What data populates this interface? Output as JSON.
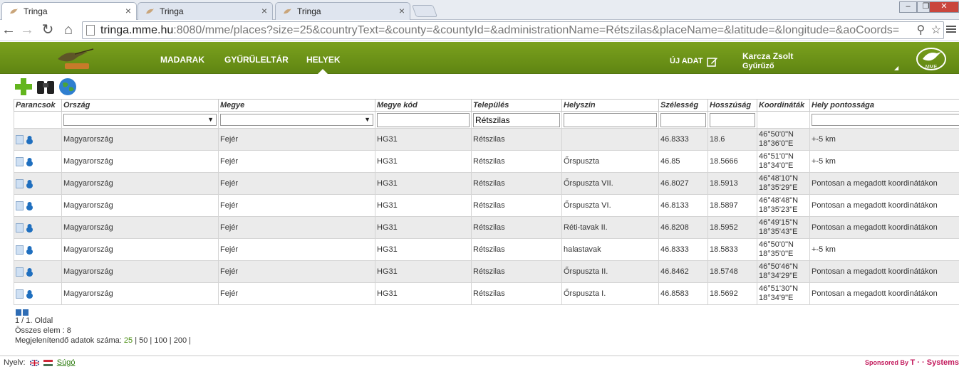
{
  "browser": {
    "tabs": [
      {
        "title": "Tringa"
      },
      {
        "title": "Tringa"
      },
      {
        "title": "Tringa"
      }
    ],
    "url_host": "tringa.mme.hu",
    "url_rest": ":8080/mme/places?size=25&countryText=&county=&countyId=&administrationName=Rétszilas&placeName=&latitude=&longitude=&aoCoords="
  },
  "header": {
    "nav": [
      "MADARAK",
      "GYŰRŰLELTÁR",
      "HELYEK"
    ],
    "new_data": "ÚJ ADAT",
    "user_name": "Karcza Zsolt",
    "user_role": "Gyűrűző"
  },
  "columns": [
    "Parancsok",
    "Ország",
    "Megye",
    "Megye kód",
    "Település",
    "Helyszín",
    "Szélesség",
    "Hosszúság",
    "Koordináták",
    "Hely pontossága"
  ],
  "filters": {
    "settlement": "Rétszilas"
  },
  "rows": [
    {
      "country": "Magyarország",
      "county": "Fejér",
      "code": "HG31",
      "settlement": "Rétszilas",
      "place": "",
      "lat": "46.8333",
      "lon": "18.6",
      "coord1": "46°50'0\"N",
      "coord2": "18°36'0\"E",
      "accuracy": "+-5 km"
    },
    {
      "country": "Magyarország",
      "county": "Fejér",
      "code": "HG31",
      "settlement": "Rétszilas",
      "place": "Őrspuszta",
      "lat": "46.85",
      "lon": "18.5666",
      "coord1": "46°51'0\"N",
      "coord2": "18°34'0\"E",
      "accuracy": "+-5 km"
    },
    {
      "country": "Magyarország",
      "county": "Fejér",
      "code": "HG31",
      "settlement": "Rétszilas",
      "place": "Őrspuszta VII.",
      "lat": "46.8027",
      "lon": "18.5913",
      "coord1": "46°48'10\"N",
      "coord2": "18°35'29\"E",
      "accuracy": "Pontosan a megadott koordinátákon"
    },
    {
      "country": "Magyarország",
      "county": "Fejér",
      "code": "HG31",
      "settlement": "Rétszilas",
      "place": "Őrspuszta VI.",
      "lat": "46.8133",
      "lon": "18.5897",
      "coord1": "46°48'48\"N",
      "coord2": "18°35'23\"E",
      "accuracy": "Pontosan a megadott koordinátákon"
    },
    {
      "country": "Magyarország",
      "county": "Fejér",
      "code": "HG31",
      "settlement": "Rétszilas",
      "place": "Réti-tavak II.",
      "lat": "46.8208",
      "lon": "18.5952",
      "coord1": "46°49'15\"N",
      "coord2": "18°35'43\"E",
      "accuracy": "Pontosan a megadott koordinátákon"
    },
    {
      "country": "Magyarország",
      "county": "Fejér",
      "code": "HG31",
      "settlement": "Rétszilas",
      "place": "halastavak",
      "lat": "46.8333",
      "lon": "18.5833",
      "coord1": "46°50'0\"N",
      "coord2": "18°35'0\"E",
      "accuracy": "+-5 km"
    },
    {
      "country": "Magyarország",
      "county": "Fejér",
      "code": "HG31",
      "settlement": "Rétszilas",
      "place": "Őrspuszta II.",
      "lat": "46.8462",
      "lon": "18.5748",
      "coord1": "46°50'46\"N",
      "coord2": "18°34'29\"E",
      "accuracy": "Pontosan a megadott koordinátákon"
    },
    {
      "country": "Magyarország",
      "county": "Fejér",
      "code": "HG31",
      "settlement": "Rétszilas",
      "place": "Őrspuszta I.",
      "lat": "46.8583",
      "lon": "18.5692",
      "coord1": "46°51'30\"N",
      "coord2": "18°34'9\"E",
      "accuracy": "Pontosan a megadott koordinátákon"
    }
  ],
  "pager": {
    "page_info": "1 / 1. Oldal",
    "total": "Összes elem : 8",
    "size_label": "Megjelenítendő adatok száma:",
    "sizes": [
      "25",
      "50",
      "100",
      "200"
    ]
  },
  "footer": {
    "lang_label": "Nyelv:",
    "help": "Súgó",
    "sponsor": "Sponsored By",
    "sponsor_brand": "T · · Systems"
  },
  "colors": {
    "header_green": "#6f9418",
    "row_alt": "#ebebeb",
    "link_green": "#2e7c10",
    "sponsor_magenta": "#c2185b"
  }
}
